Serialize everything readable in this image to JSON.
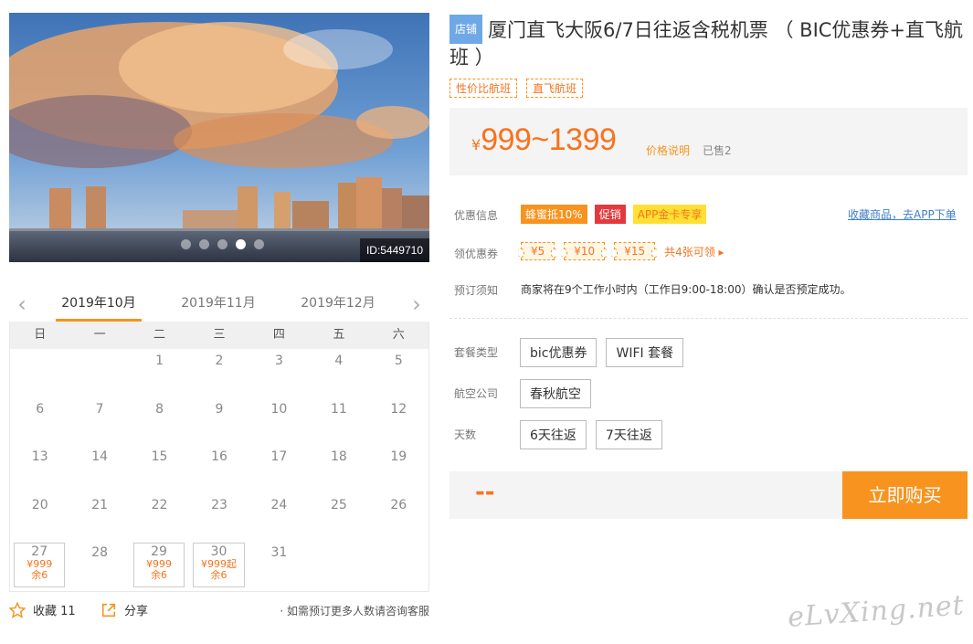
{
  "gallery": {
    "image_id": "ID:5449710",
    "slide_count": 5,
    "active_slide": 4
  },
  "calendar": {
    "months": [
      "2019年10月",
      "2019年11月",
      "2019年12月"
    ],
    "active_month": "2019年10月",
    "weekdays": [
      "日",
      "一",
      "二",
      "三",
      "四",
      "五",
      "六"
    ],
    "days": [
      {
        "d": ""
      },
      {
        "d": ""
      },
      {
        "d": "1"
      },
      {
        "d": "2"
      },
      {
        "d": "3"
      },
      {
        "d": "4"
      },
      {
        "d": "5"
      },
      {
        "d": "6"
      },
      {
        "d": "7"
      },
      {
        "d": "8"
      },
      {
        "d": "9"
      },
      {
        "d": "10"
      },
      {
        "d": "11"
      },
      {
        "d": "12"
      },
      {
        "d": "13"
      },
      {
        "d": "14"
      },
      {
        "d": "15"
      },
      {
        "d": "16"
      },
      {
        "d": "17"
      },
      {
        "d": "18"
      },
      {
        "d": "19"
      },
      {
        "d": "20"
      },
      {
        "d": "21"
      },
      {
        "d": "22"
      },
      {
        "d": "23"
      },
      {
        "d": "24"
      },
      {
        "d": "25"
      },
      {
        "d": "26"
      },
      {
        "d": "27",
        "price": "¥999",
        "left": "余6"
      },
      {
        "d": "28"
      },
      {
        "d": "29",
        "price": "¥999",
        "left": "余6"
      },
      {
        "d": "30",
        "price": "¥999起",
        "left": "余6"
      },
      {
        "d": "31"
      }
    ]
  },
  "footer_left": {
    "favorite": "收藏 11",
    "share": "分享",
    "consult": "· 如需预订更多人数请咨询客服"
  },
  "product": {
    "shop_tag": "店铺",
    "title": "厦门直飞大阪6/7日往返含税机票 （ BIC优惠券+直飞航班 ）",
    "tags": [
      "性价比航班",
      "直飞航班"
    ],
    "price_symbol": "¥",
    "price_range": "999~1399",
    "price_note": "价格说明",
    "sold": "已售2"
  },
  "info": {
    "promo_label": "优惠信息",
    "promo_chips": [
      "蜂蜜抵10%",
      "促销",
      "APP金卡专享"
    ],
    "app_link": "收藏商品，去APP下单",
    "coupon_label": "领优惠券",
    "coupons": [
      "¥5",
      "¥10",
      "¥15"
    ],
    "coupon_more": "共4张可领 ▸",
    "notice_label": "预订须知",
    "notice_text": "商家将在9个工作小时内（工作日9:00-18:00）确认是否预定成功。"
  },
  "options": {
    "package_label": "套餐类型",
    "packages": [
      "bic优惠券",
      "WIFI 套餐"
    ],
    "airline_label": "航空公司",
    "airlines": [
      "春秋航空"
    ],
    "days_label": "天数",
    "days": [
      "6天往返",
      "7天往返"
    ]
  },
  "purchase": {
    "total": "--",
    "buy_label": "立即购买"
  },
  "watermark": "eLvXing.net",
  "colors": {
    "accent": "#f7931e",
    "price": "#f7731e",
    "red": "#e4393c",
    "link": "#3d7ecb",
    "shop_tag": "#6fa8e6"
  }
}
